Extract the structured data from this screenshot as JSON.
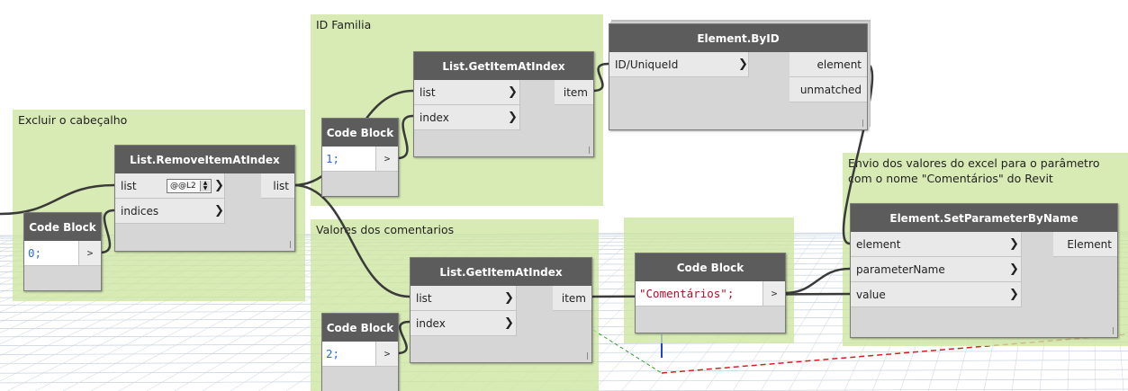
{
  "groups": {
    "excluir": "Excluir o cabeçalho",
    "id_familia": "ID Familia",
    "valores": "Valores dos comentarios",
    "envio": "Envio dos valores do excel para o parâmetro\ncom o nome \"Comentários\" do Revit"
  },
  "nodes": {
    "code_block_0": {
      "title": "Code Block",
      "code": "0;",
      "out": ">"
    },
    "remove_item": {
      "title": "List.RemoveItemAtIndex",
      "in1": "list",
      "in2": "indices",
      "out": "list",
      "lacing": "@@L2"
    },
    "code_block_1": {
      "title": "Code Block",
      "code": "1;",
      "out": ">"
    },
    "get_item_1": {
      "title": "List.GetItemAtIndex",
      "in1": "list",
      "in2": "index",
      "out": "item"
    },
    "element_byid": {
      "title": "Element.ByID",
      "in1": "ID/UniqueId",
      "out1": "element",
      "out2": "unmatched"
    },
    "code_block_2": {
      "title": "Code Block",
      "code": "2;",
      "out": ">"
    },
    "get_item_2": {
      "title": "List.GetItemAtIndex",
      "in1": "list",
      "in2": "index",
      "out": "item"
    },
    "code_block_str": {
      "title": "Code Block",
      "code": "\"Comentários\";",
      "out": ">"
    },
    "set_param": {
      "title": "Element.SetParameterByName",
      "in1": "element",
      "in2": "parameterName",
      "in3": "value",
      "out": "Element"
    }
  },
  "icons": {
    "port_chevron": "chevron-right-icon",
    "code_output": "output-arrow-icon"
  },
  "colors": {
    "group": "#cde5a0",
    "node_header": "#5c5c5c",
    "wire": "#3a3a3a",
    "number": "#2b6fd6",
    "string": "#a3152b"
  }
}
